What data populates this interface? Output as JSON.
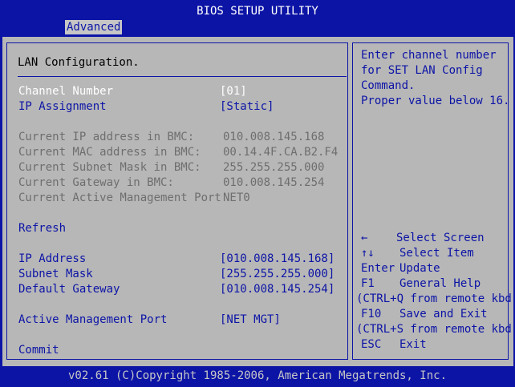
{
  "title": "BIOS SETUP UTILITY",
  "tabs": [
    {
      "label": "Advanced",
      "active": true
    }
  ],
  "section_title": "LAN Configuration.",
  "items": {
    "channel_number": {
      "label": "Channel Number",
      "value": "[01]"
    },
    "ip_assignment": {
      "label": "IP Assignment",
      "value": "[Static]"
    }
  },
  "current_info": [
    {
      "label": "Current IP address in BMC:",
      "value": "010.008.145.168"
    },
    {
      "label": "Current MAC address in BMC:",
      "value": "00.14.4F.CA.B2.F4"
    },
    {
      "label": "Current Subnet Mask in BMC:",
      "value": "255.255.255.000"
    },
    {
      "label": "Current Gateway in BMC:",
      "value": "010.008.145.254"
    },
    {
      "label": "Current Active Management Port",
      "value": "NET0"
    }
  ],
  "refresh_label": "Refresh",
  "network": [
    {
      "label": "IP Address",
      "value": "[010.008.145.168]"
    },
    {
      "label": "Subnet Mask",
      "value": "[255.255.255.000]"
    },
    {
      "label": "Default Gateway",
      "value": "[010.008.145.254]"
    }
  ],
  "active_port": {
    "label": "Active Management Port",
    "value": "[NET MGT]"
  },
  "commit_label": "Commit",
  "help_text": [
    "Enter channel number",
    "for SET LAN Config",
    "Command.",
    "Proper value below 16."
  ],
  "keys": [
    {
      "key": "←",
      "desc": "Select Screen"
    },
    {
      "key": "↑↓",
      "desc": "Select Item"
    },
    {
      "key": "Enter",
      "desc": "Update"
    },
    {
      "key": "F1",
      "desc": "General Help"
    },
    {
      "full": "(CTRL+Q from remote kbd)"
    },
    {
      "key": "F10",
      "desc": "Save and Exit"
    },
    {
      "full": "(CTRL+S from remote kbd)"
    },
    {
      "key": "ESC",
      "desc": "Exit"
    }
  ],
  "footer": "v02.61 (C)Copyright 1985-2006, American Megatrends, Inc.",
  "colors": {
    "background_blue": "#0c14a6",
    "panel_gray": "#b7b7b7",
    "selected_text": "#ffffff",
    "disabled_text": "#6e6e6e"
  }
}
